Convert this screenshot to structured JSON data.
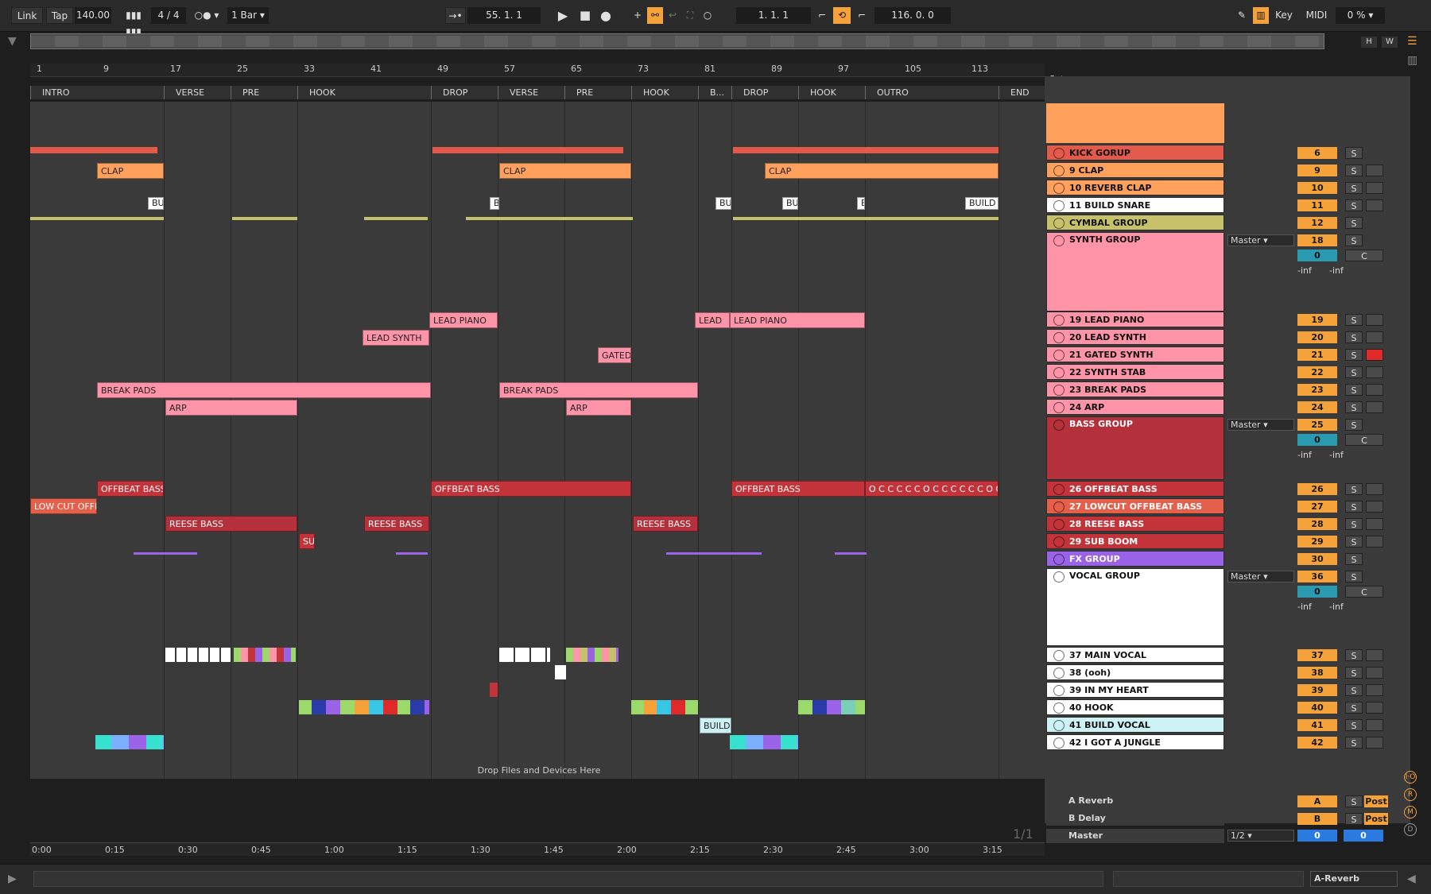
{
  "control_bar": {
    "link": "Link",
    "tap": "Tap",
    "tempo": "140.00",
    "time_sig": "4 / 4",
    "quantize": "1 Bar",
    "position": "55.  1.  1",
    "loop_start": "1.  1.  1",
    "loop_length": "116.  0.  0",
    "key": "Key",
    "midi": "MIDI",
    "cpu": "0 %"
  },
  "overview": {
    "h": "H",
    "w": "W"
  },
  "ruler": [
    "1",
    "9",
    "17",
    "25",
    "33",
    "41",
    "49",
    "57",
    "65",
    "73",
    "81",
    "89",
    "97",
    "105",
    "113"
  ],
  "locators": [
    "INTRO",
    "VERSE",
    "PRE",
    "HOOK",
    "DROP",
    "VERSE",
    "PRE",
    "HOOK",
    "B...",
    "DROP",
    "HOOK",
    "OUTRO",
    "END"
  ],
  "set_label": "Set",
  "tracks": [
    {
      "name": "KICK GORUP",
      "num": "6",
      "group": true,
      "color": "#e45a4a"
    },
    {
      "name": "9 CLAP",
      "num": "9",
      "color": "#ffa15c"
    },
    {
      "name": "10 REVERB CLAP",
      "num": "10",
      "color": "#ffa15c"
    },
    {
      "name": "11 BUILD SNARE",
      "num": "11",
      "color": "#ffffff"
    },
    {
      "name": "CYMBAL GROUP",
      "num": "12",
      "group": true,
      "color": "#c6c16a"
    },
    {
      "name": "SYNTH GROUP",
      "num": "18",
      "group": true,
      "color": "#ff93a7"
    },
    {
      "name": "19 LEAD PIANO",
      "num": "19",
      "color": "#ff93a7"
    },
    {
      "name": "20 LEAD SYNTH",
      "num": "20",
      "color": "#ff93a7"
    },
    {
      "name": "21 GATED SYNTH",
      "num": "21",
      "color": "#ff93a7"
    },
    {
      "name": "22 SYNTH STAB",
      "num": "22",
      "color": "#ff93a7"
    },
    {
      "name": "23 BREAK PADS",
      "num": "23",
      "color": "#ff93a7"
    },
    {
      "name": "24 ARP",
      "num": "24",
      "color": "#ff93a7"
    },
    {
      "name": "BASS GROUP",
      "num": "25",
      "group": true,
      "color": "#b4303a"
    },
    {
      "name": "26 OFFBEAT BASS",
      "num": "26",
      "color": "#c3343a"
    },
    {
      "name": "27 LOWCUT OFFBEAT BASS",
      "num": "27",
      "color": "#e4604a"
    },
    {
      "name": "28 REESE BASS",
      "num": "28",
      "color": "#c3343a"
    },
    {
      "name": "29 SUB BOOM",
      "num": "29",
      "color": "#c3343a"
    },
    {
      "name": "FX GROUP",
      "num": "30",
      "group": true,
      "color": "#9a62e6"
    },
    {
      "name": "VOCAL GROUP",
      "num": "36",
      "group": true,
      "color": "#ffffff"
    },
    {
      "name": "37 MAIN VOCAL",
      "num": "37",
      "color": "#ffffff"
    },
    {
      "name": "38 (ooh)",
      "num": "38",
      "color": "#ffffff"
    },
    {
      "name": "39 IN MY HEART",
      "num": "39",
      "color": "#ffffff"
    },
    {
      "name": "40 HOOK",
      "num": "40",
      "color": "#ffffff"
    },
    {
      "name": "41 BUILD VOCAL",
      "num": "41",
      "color": "#cdf2f5"
    },
    {
      "name": "42 I GOT A JUNGLE",
      "num": "42",
      "color": "#ffffff"
    }
  ],
  "clips": {
    "clap1": "CLAP",
    "clap2": "CLAP",
    "clap3": "CLAP",
    "lead_piano1": "LEAD PIANO",
    "lead_piano2": "LEAD PIANO",
    "lead_piano3": "LEAD",
    "lead_synth": "LEAD SYNTH",
    "gated": "GATED",
    "break1": "BREAK PADS",
    "break2": "BREAK PADS",
    "arp1": "ARP",
    "arp2": "ARP",
    "offbeat1": "OFFBEAT BASS",
    "offbeat2": "OFFBEAT BASS",
    "offbeat3": "OFFBEAT BASS",
    "lowcut": "LOW CUT OFFE",
    "reese1": "REESE BASS",
    "reese2": "REESE BASS",
    "reese3": "REESE BASS",
    "sub": "SUI",
    "build_vocal": "BUILD V",
    "outro_bass": "O C C C C C O C C C C C C O C",
    "build_snare1": "BU",
    "build_snare2": "B",
    "build_snare3": "BU",
    "build_snare4": "BU",
    "build_snare5": "B",
    "build_snare6": "BUILD S"
  },
  "drop_hint": "Drop Files and Devices Here",
  "returns": [
    {
      "name": "A Reverb",
      "num": "A",
      "post": "Post"
    },
    {
      "name": "B Delay",
      "num": "B",
      "post": "Post"
    },
    {
      "name": "Master",
      "num": "0",
      "post": "0",
      "io": "1/2"
    }
  ],
  "group_io": {
    "out": "Master",
    "pan": "0",
    "c": "C",
    "inf": "-inf"
  },
  "page_counter": "1/1",
  "timeline": [
    "0:00",
    "0:15",
    "0:30",
    "0:45",
    "1:00",
    "1:15",
    "1:30",
    "1:45",
    "2:00",
    "2:15",
    "2:30",
    "2:45",
    "3:00",
    "3:15"
  ],
  "status": {
    "device": "A-Reverb"
  }
}
